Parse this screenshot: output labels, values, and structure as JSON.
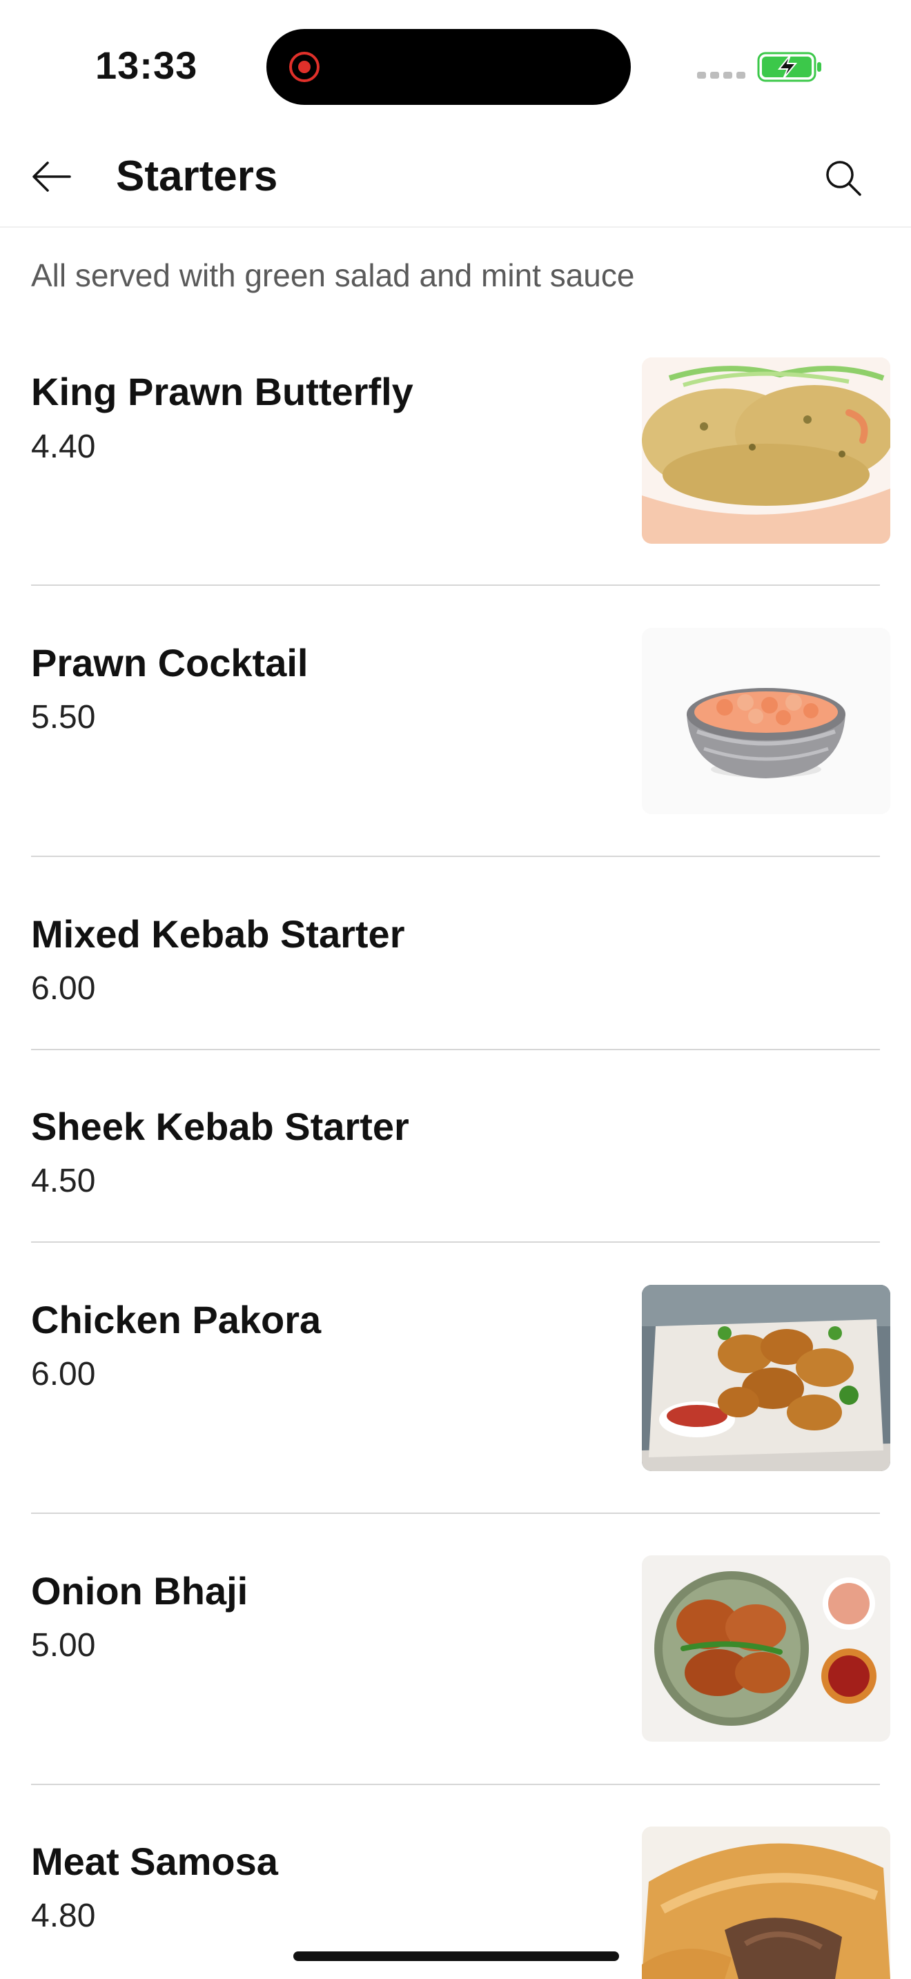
{
  "status_bar": {
    "time": "13:33",
    "icons": [
      "recording-indicator",
      "signal-dots",
      "battery-charging"
    ]
  },
  "header": {
    "back_icon": "arrow-left-icon",
    "title": "Starters",
    "search_icon": "search-icon"
  },
  "subtitle": "All served with green salad and mint sauce",
  "items": [
    {
      "name": "King Prawn Butterfly",
      "price": "4.40",
      "image": "fried-prawn-bowl"
    },
    {
      "name": "Prawn Cocktail",
      "price": "5.50",
      "image": "prawn-bowl"
    },
    {
      "name": "Mixed Kebab Starter",
      "price": "6.00",
      "image": ""
    },
    {
      "name": "Sheek Kebab Starter",
      "price": "4.50",
      "image": ""
    },
    {
      "name": "Chicken Pakora",
      "price": "6.00",
      "image": "chicken-pakora-board"
    },
    {
      "name": "Onion Bhaji",
      "price": "5.00",
      "image": "onion-bhaji-plate"
    },
    {
      "name": "Meat Samosa",
      "price": "4.80",
      "image": "meat-samosa"
    }
  ],
  "colors": {
    "battery_green": "#3cc84a",
    "record_red": "#e0302a",
    "divider": "#d6d6d6"
  }
}
